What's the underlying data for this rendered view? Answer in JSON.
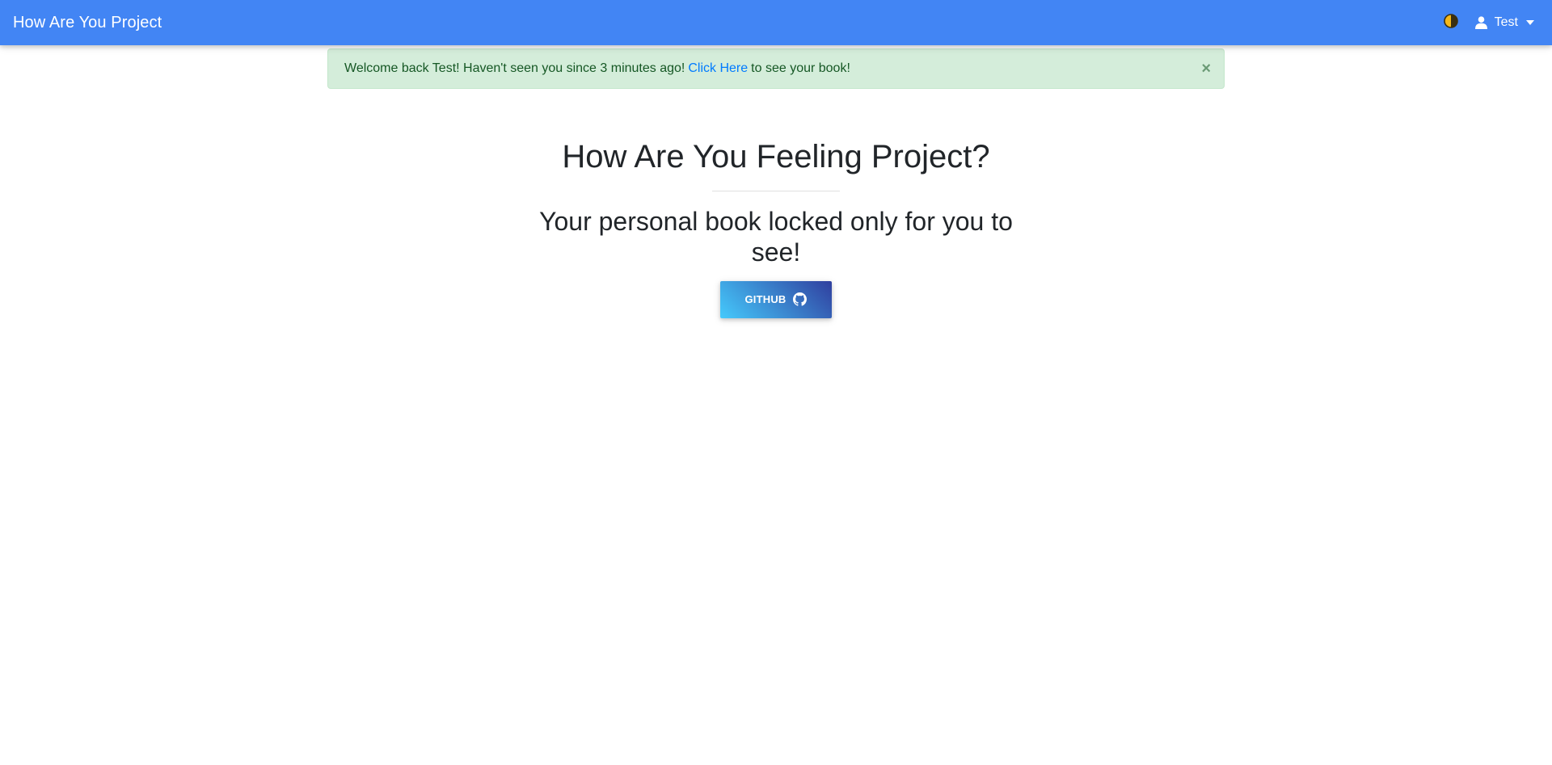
{
  "navbar": {
    "brand": "How Are You Project",
    "theme_toggle_icon": "half-moon-contrast-icon",
    "user": {
      "icon": "user-icon",
      "name": "Test"
    },
    "background": "#4285f4"
  },
  "alert": {
    "text_before": "Welcome back Test! Haven't seen you since 3 minutes ago!",
    "link_text": "Click Here",
    "text_after": "to see your book!",
    "close_symbol": "×",
    "background": "#d4edda",
    "link_color": "#007bff"
  },
  "hero": {
    "title": "How Are You Feeling Project?",
    "subtitle": "Your personal book locked only for you to see!",
    "github_button": {
      "label": "GITHUB",
      "icon": "github-icon"
    }
  }
}
